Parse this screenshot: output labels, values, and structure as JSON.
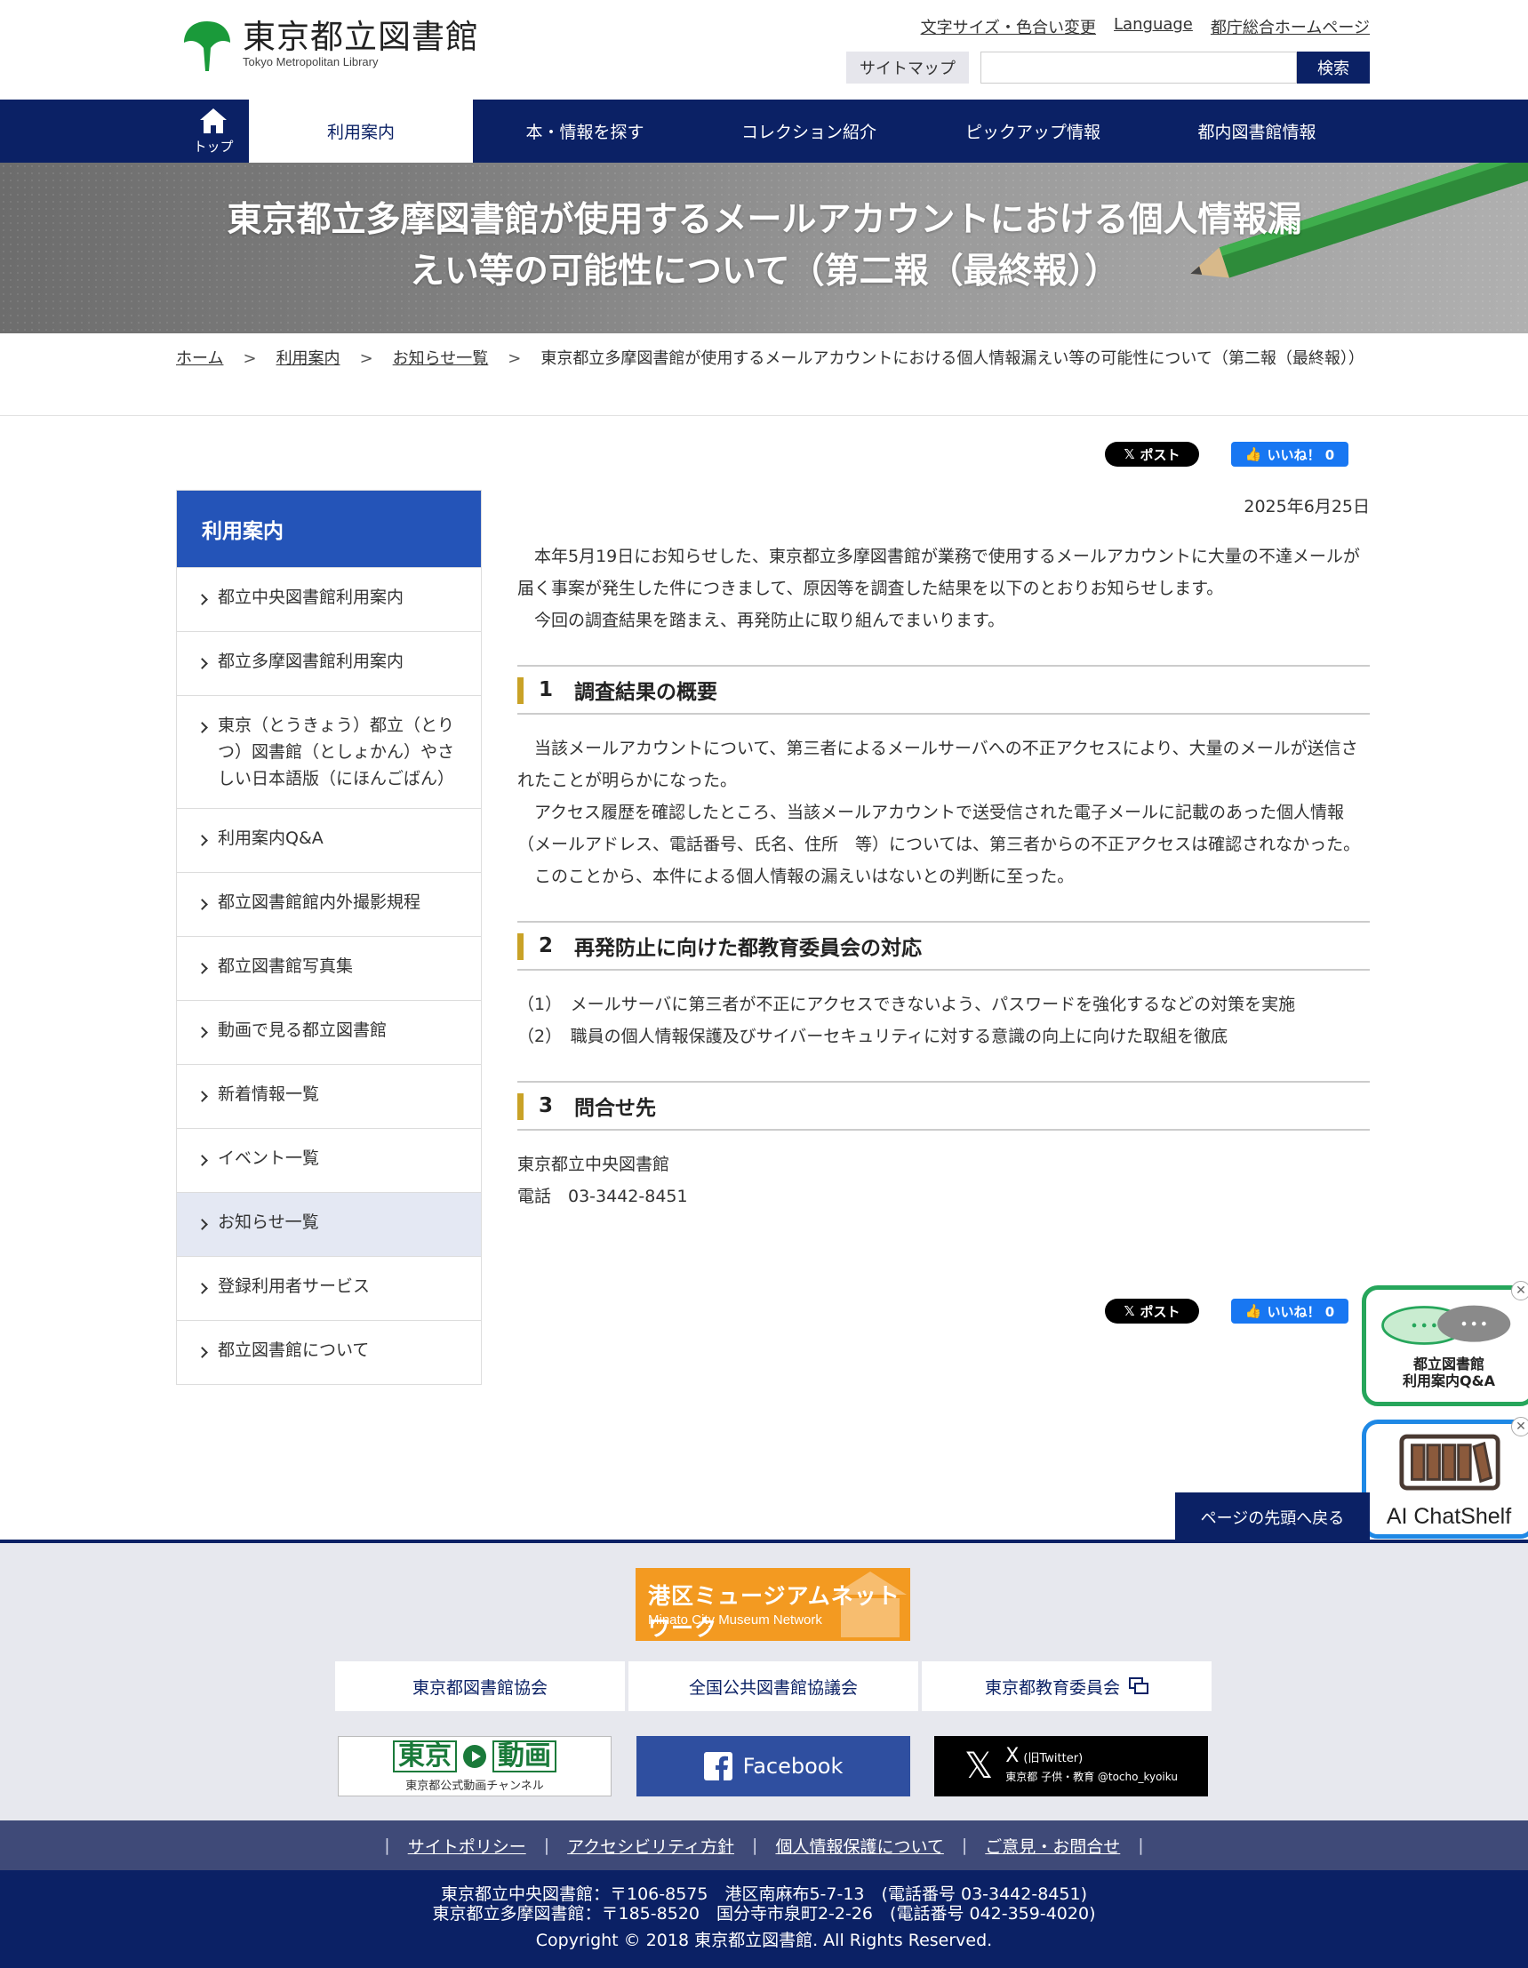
{
  "header": {
    "logo_jp": "東京都立図書館",
    "logo_en": "Tokyo Metropolitan Library",
    "util_links": [
      "文字サイズ・色合い変更",
      "Language",
      "都庁総合ホームページ"
    ],
    "sitemap_label": "サイトマップ",
    "search_value": "",
    "search_button": "検索"
  },
  "nav": {
    "home_label": "トップ",
    "items": [
      "利用案内",
      "本・情報を探す",
      "コレクション紹介",
      "ピックアップ情報",
      "都内図書館情報"
    ],
    "active_index": 0
  },
  "hero": {
    "title_line1": "東京都立多摩図書館が使用するメールアカウントにおける個人情報漏",
    "title_line2": "えい等の可能性について（第二報（最終報））"
  },
  "breadcrumb": {
    "home": "ホーム",
    "guide": "利用案内",
    "news_list": "お知らせ一覧",
    "current": "東京都立多摩図書館が使用するメールアカウントにおける個人情報漏えい等の可能性について（第二報（最終報））",
    "separator": ">"
  },
  "social": {
    "x_label": "ポスト",
    "fb_label": "いいね！ 0"
  },
  "sidebar": {
    "title": "利用案内",
    "items": [
      "都立中央図書館利用案内",
      "都立多摩図書館利用案内",
      "東京（とうきょう）都立（とりつ）図書館（としょかん）やさしい日本語版（にほんごばん）",
      "利用案内Q&A",
      "都立図書館館内外撮影規程",
      "都立図書館写真集",
      "動画で見る都立図書館",
      "新着情報一覧",
      "イベント一覧",
      "お知らせ一覧",
      "登録利用者サービス",
      "都立図書館について"
    ],
    "current_index": 9
  },
  "article": {
    "date": "2025年6月25日",
    "intro": [
      "　本年5月19日にお知らせした、東京都立多摩図書館が業務で使用するメールアカウントに大量の不達メールが届く事案が発生した件につきまして、原因等を調査した結果を以下のとおりお知らせします。",
      "　今回の調査結果を踏まえ、再発防止に取り組んでまいります。"
    ],
    "sections": [
      {
        "num": "1",
        "title": "調査結果の概要",
        "paragraphs": [
          "　当該メールアカウントについて、第三者によるメールサーバへの不正アクセスにより、大量のメールが送信されたことが明らかになった。",
          "　アクセス履歴を確認したところ、当該メールアカウントで送受信された電子メールに記載のあった個人情報（メールアドレス、電話番号、氏名、住所　等）については、第三者からの不正アクセスは確認されなかった。",
          "　このことから、本件による個人情報の漏えいはないとの判断に至った。"
        ]
      },
      {
        "num": "2",
        "title": "再発防止に向けた都教育委員会の対応",
        "paragraphs": [
          "（1）　メールサーバに第三者が不正にアクセスできないよう、パスワードを強化するなどの対策を実施",
          "（2）　職員の個人情報保護及びサイバーセキュリティに対する意識の向上に向けた取組を徹底"
        ]
      },
      {
        "num": "3",
        "title": "問合せ先",
        "paragraphs": [
          "東京都立中央図書館",
          "電話　03-3442-8451"
        ]
      }
    ]
  },
  "pagetop_label": "ページの先頭へ戻る",
  "floating": {
    "qa_label_1": "都立図書館",
    "qa_label_2": "利用案内Q&A",
    "ai_label": "AI ChatShelf",
    "close_glyph": "✕"
  },
  "footer": {
    "minato_jp": "港区ミュージアムネットワーク",
    "minato_en": "Minato City Museum Network",
    "links": [
      "東京都図書館協会",
      "全国公共図書館協議会",
      "東京都教育委員会"
    ],
    "tokyo_douga_1": "東京",
    "tokyo_douga_2": "動画",
    "tokyo_douga_sub": "東京都公式動画チャンネル",
    "facebook": "Facebook",
    "x_title": "X",
    "x_old": "(旧Twitter)",
    "x_account": "東京都 子供・教育 @tocho_kyoiku",
    "policy_links": [
      "サイトポリシー",
      "アクセシビリティ方針",
      "個人情報保護について",
      "ご意見・お問合せ"
    ],
    "address_1": "東京都立中央図書館：〒106-8575　港区南麻布5-7-13　(電話番号 03-3442-8451)",
    "address_2": "東京都立多摩図書館：〒185-8520　国分寺市泉町2-2-26　(電話番号 042-359-4020)",
    "copyright": "Copyright © 2018 東京都立図書館. All Rights Reserved."
  },
  "colors": {
    "navy": "#0b2165",
    "side_head": "#2454b8",
    "accent_gold": "#c9a227",
    "logo_green": "#1a9a3a",
    "minato_orange": "#f39a21"
  }
}
